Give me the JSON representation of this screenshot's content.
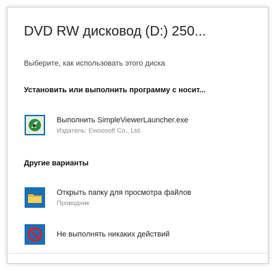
{
  "dialog": {
    "title": "DVD RW дисковод (D:) 250...",
    "subtitle": "Выберите, как использовать этого диска"
  },
  "section_install": {
    "heading": "Установить или выполнить программу с носит..."
  },
  "run_option": {
    "label": "Выполнить SimpleViewerLauncher.exe",
    "publisher": "Издатель: Ewoosoft Co., Ltd.",
    "icon": "launcher-app-icon"
  },
  "section_other": {
    "heading": "Другие варианты"
  },
  "open_folder_option": {
    "label": "Открыть папку для просмотра файлов",
    "sub": "Проводник",
    "icon": "folder-icon"
  },
  "no_action_option": {
    "label": "Не выполнять никаких действий",
    "icon": "no-action-icon"
  },
  "colors": {
    "accent": "#1a6fb5",
    "no_action_red": "#c62833"
  }
}
